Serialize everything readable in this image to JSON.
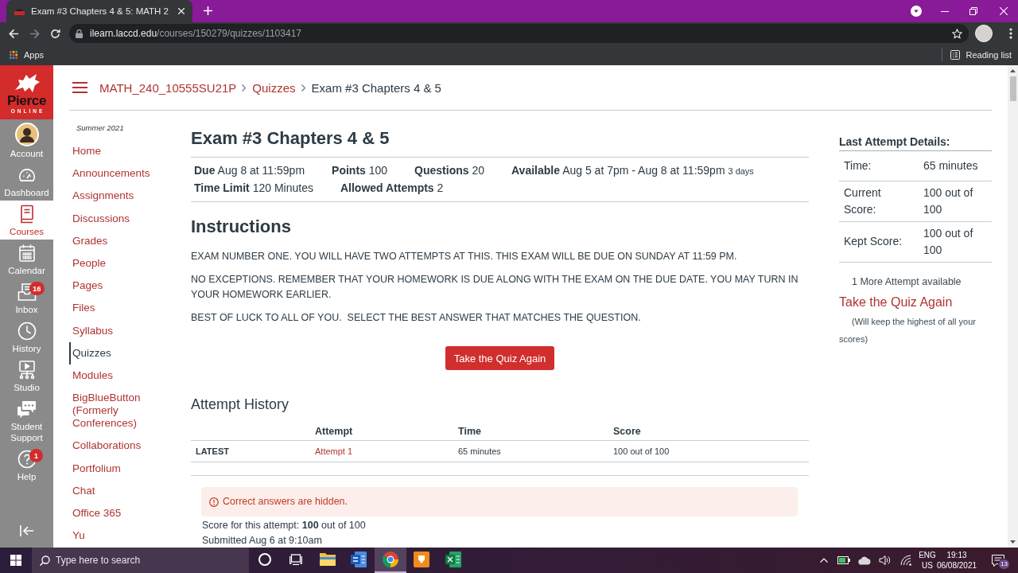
{
  "browser": {
    "tab": {
      "title": "Exam #3 Chapters 4 & 5: MATH 2"
    },
    "address_bar": {
      "domain": "ilearn.laccd.edu",
      "path": "/courses/150279/quizzes/1103417"
    },
    "bookmarks_bar": {
      "apps": "Apps",
      "reading_list": "Reading list"
    }
  },
  "logo": {
    "name": "Pierce",
    "tagline": "ONLINE"
  },
  "global_nav": {
    "items": [
      {
        "kind": "account",
        "label": "Account",
        "selected": false
      },
      {
        "kind": "dashboard",
        "label": "Dashboard",
        "selected": false
      },
      {
        "kind": "courses",
        "label": "Courses",
        "selected": true
      },
      {
        "kind": "calendar",
        "label": "Calendar",
        "selected": false
      },
      {
        "kind": "inbox",
        "label": "Inbox",
        "selected": false,
        "badge": "16"
      },
      {
        "kind": "history",
        "label": "History",
        "selected": false
      },
      {
        "kind": "studio",
        "label": "Studio",
        "selected": false
      },
      {
        "kind": "support",
        "label": "Student Support",
        "selected": false
      },
      {
        "kind": "help",
        "label": "Help",
        "selected": false,
        "badge": "1"
      }
    ]
  },
  "breadcrumb": [
    {
      "kind": "link",
      "label": "MATH_240_10555SU21P"
    },
    {
      "kind": "link",
      "label": "Quizzes"
    },
    {
      "kind": "current",
      "label": "Exam #3 Chapters 4 & 5"
    }
  ],
  "course_nav": {
    "term": "Summer 2021",
    "items": [
      {
        "label": "Home",
        "selected": false
      },
      {
        "label": "Announcements",
        "selected": false
      },
      {
        "label": "Assignments",
        "selected": false
      },
      {
        "label": "Discussions",
        "selected": false
      },
      {
        "label": "Grades",
        "selected": false
      },
      {
        "label": "People",
        "selected": false
      },
      {
        "label": "Pages",
        "selected": false
      },
      {
        "label": "Files",
        "selected": false
      },
      {
        "label": "Syllabus",
        "selected": false
      },
      {
        "label": "Quizzes",
        "selected": true
      },
      {
        "label": "Modules",
        "selected": false
      },
      {
        "label": "BigBlueButton (Formerly Conferences)",
        "selected": false
      },
      {
        "label": "Collaborations",
        "selected": false
      },
      {
        "label": "Portfolium",
        "selected": false
      },
      {
        "label": "Chat",
        "selected": false
      },
      {
        "label": "Office 365",
        "selected": false
      },
      {
        "label": "Yu",
        "selected": false
      }
    ]
  },
  "quiz": {
    "title": "Exam #3 Chapters 4 & 5",
    "details": [
      [
        {
          "label": "Due",
          "value": "Aug 8 at 11:59pm"
        },
        {
          "label": "Points",
          "value": "100"
        },
        {
          "label": "Questions",
          "value": "20"
        },
        {
          "label": "Available",
          "value": "Aug 5 at 7pm - Aug 8 at 11:59pm",
          "note": "3 days"
        }
      ],
      [
        {
          "label": "Time Limit",
          "value": "120 Minutes"
        },
        {
          "label": "Allowed Attempts",
          "value": "2"
        }
      ]
    ],
    "instructions": {
      "heading": "Instructions",
      "paragraphs": [
        "EXAM NUMBER ONE. YOU WILL HAVE TWO ATTEMPTS AT THIS. THIS EXAM WILL BE DUE ON SUNDAY AT 11:59 PM.",
        "NO EXCEPTIONS. REMEMBER THAT YOUR HOMEWORK IS DUE ALONG WITH THE EXAM ON THE DUE DATE. YOU MAY TURN IN YOUR HOMEWORK EARLIER.",
        "BEST OF LUCK TO ALL OF YOU.  SELECT THE BEST ANSWER THAT MATCHES THE QUESTION."
      ]
    },
    "take_quiz_button": "Take the Quiz Again"
  },
  "attempt_history": {
    "heading": "Attempt History",
    "columns": [
      "Attempt",
      "Time",
      "Score"
    ],
    "rows": [
      {
        "label": "LATEST",
        "attempt": "Attempt 1",
        "time": "65 minutes",
        "score": "100 out of 100"
      }
    ]
  },
  "result": {
    "alert": "Correct answers are hidden.",
    "score": "Score for this attempt: **100** out of 100",
    "submitted": "Submitted Aug 6 at 9:10am"
  },
  "sidebar": {
    "heading": "Last Attempt Details:",
    "rows": [
      {
        "label": "Time:",
        "value": "65 minutes"
      },
      {
        "label": "Current Score:",
        "value": "100 out of 100"
      },
      {
        "label": "Kept Score:",
        "value": "100 out of 100"
      }
    ],
    "attempts_note": "1 More Attempt available",
    "retake_link": "Take the Quiz Again",
    "retake_note": "(Will keep the highest of all your scores)"
  },
  "taskbar": {
    "search": {
      "placeholder": "Type here to search"
    },
    "apps": [
      {
        "kind": "cortana",
        "selected": false
      },
      {
        "kind": "task_view",
        "selected": false
      },
      {
        "kind": "explorer",
        "selected": false
      },
      {
        "kind": "word",
        "selected": false
      },
      {
        "kind": "chrome",
        "selected": true
      },
      {
        "kind": "orange_app",
        "selected": false
      },
      {
        "kind": "excel",
        "selected": false
      }
    ],
    "language": "ENG",
    "region": "US",
    "time": "19:13",
    "date": "06/08/2021",
    "notifications": "13"
  }
}
